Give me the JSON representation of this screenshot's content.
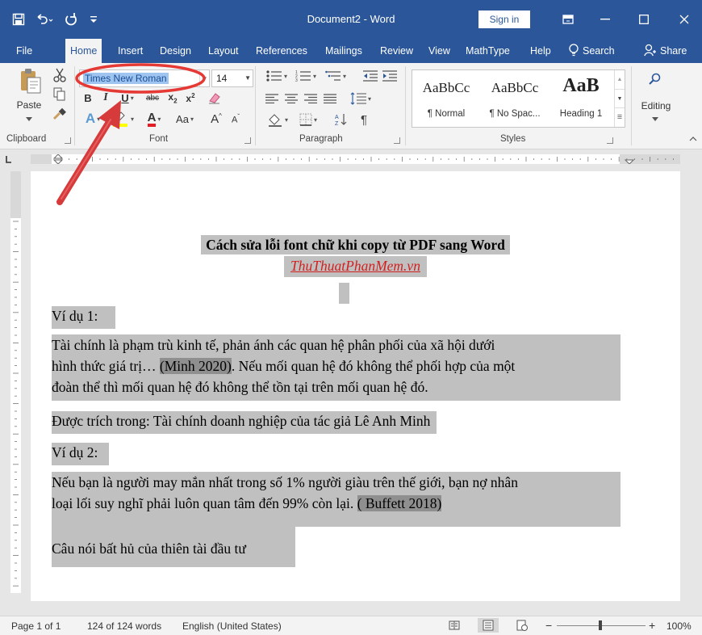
{
  "window": {
    "title": "Document2 - Word",
    "sign_in_label": "Sign in"
  },
  "tabs": [
    {
      "label": "File"
    },
    {
      "label": "Home"
    },
    {
      "label": "Insert"
    },
    {
      "label": "Design"
    },
    {
      "label": "Layout"
    },
    {
      "label": "References"
    },
    {
      "label": "Mailings"
    },
    {
      "label": "Review"
    },
    {
      "label": "View"
    },
    {
      "label": "MathType"
    },
    {
      "label": "Help"
    }
  ],
  "search_label": "Search",
  "share_label": "Share",
  "ribbon": {
    "paste_label": "Paste",
    "font_name": "Times New Roman",
    "font_size": "14",
    "groups": {
      "clipboard": "Clipboard",
      "font": "Font",
      "paragraph": "Paragraph",
      "styles": "Styles"
    },
    "styles": [
      {
        "sample": "AaBbCc",
        "name": "¶ Normal"
      },
      {
        "sample": "AaBbCc",
        "name": "¶ No Spac..."
      },
      {
        "sample": "AaB",
        "name": "Heading 1"
      }
    ],
    "editing_label": "Editing"
  },
  "document": {
    "title": "Cách sửa lỗi font chữ khi copy từ PDF sang Word",
    "subtitle": "ThuThuatPhanMem.vn",
    "ex1_heading": "Ví dụ 1:",
    "ex1_line1": "Tài chính là phạm trù kinh tế, phản ánh các quan hệ phân phối của xã hội dưới",
    "ex1_line2a": "hình thức giá trị… ",
    "ex1_line2b": "(Minh 2020)",
    "ex1_line2c": ". Nếu mối quan hệ đó không thể phối hợp của một",
    "ex1_line3": "đoàn thể thì mối quan hệ đó không thể tồn tại trên mối quan hệ đó.",
    "ex1_source": "Được trích trong: Tài chính doanh nghiệp của tác giả Lê Anh Minh",
    "ex2_heading": "Ví dụ 2:",
    "ex2_line1": "Nếu bạn là người may mắn nhất trong số 1% người giàu trên thế giới, bạn nợ nhân",
    "ex2_line2a": "loại lối suy nghĩ phải luôn quan tâm đến 99% còn lại. ",
    "ex2_line2b": "( Buffett 2018)",
    "ex2_quote": "Câu nói bất hủ của thiên tài đầu tư"
  },
  "statusbar": {
    "page": "Page 1 of 1",
    "words": "124 of 124 words",
    "language": "English (United States)",
    "zoom": "100%"
  },
  "colors": {
    "word_blue": "#2b579a",
    "annotation_red": "#e53935",
    "highlight_gray": "#c0c0c0",
    "highlight_dark": "#8f8f8f"
  }
}
